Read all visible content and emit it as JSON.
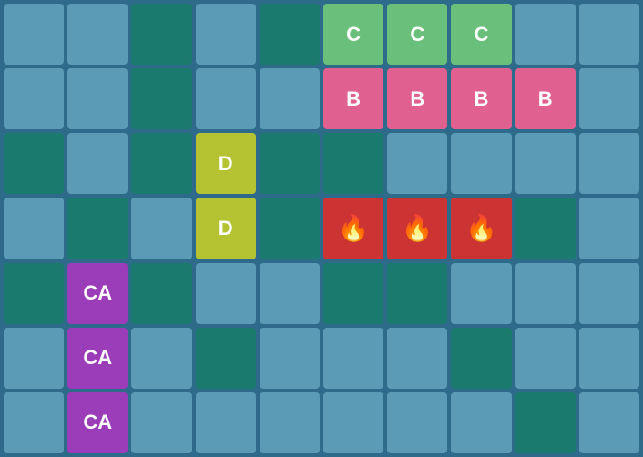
{
  "grid": {
    "cols": 10,
    "rows": 7,
    "cells": [
      {
        "id": "r0c0",
        "type": "light",
        "content": ""
      },
      {
        "id": "r0c1",
        "type": "light",
        "content": ""
      },
      {
        "id": "r0c2",
        "type": "teal",
        "content": "splash"
      },
      {
        "id": "r0c3",
        "type": "light",
        "content": ""
      },
      {
        "id": "r0c4",
        "type": "teal",
        "content": "splash"
      },
      {
        "id": "r0c5",
        "type": "green-label",
        "content": "C"
      },
      {
        "id": "r0c6",
        "type": "green-label",
        "content": "C"
      },
      {
        "id": "r0c7",
        "type": "green-label",
        "content": "C"
      },
      {
        "id": "r0c8",
        "type": "light",
        "content": ""
      },
      {
        "id": "r0c9",
        "type": "light",
        "content": ""
      },
      {
        "id": "r1c0",
        "type": "light",
        "content": ""
      },
      {
        "id": "r1c1",
        "type": "light",
        "content": ""
      },
      {
        "id": "r1c2",
        "type": "teal",
        "content": "splash"
      },
      {
        "id": "r1c3",
        "type": "light",
        "content": ""
      },
      {
        "id": "r1c4",
        "type": "light",
        "content": ""
      },
      {
        "id": "r1c5",
        "type": "pink-label",
        "content": "B"
      },
      {
        "id": "r1c6",
        "type": "pink-label",
        "content": "B"
      },
      {
        "id": "r1c7",
        "type": "pink-label",
        "content": "B"
      },
      {
        "id": "r1c8",
        "type": "pink-label",
        "content": "B"
      },
      {
        "id": "r1c9",
        "type": "light",
        "content": ""
      },
      {
        "id": "r2c0",
        "type": "teal",
        "content": "splash"
      },
      {
        "id": "r2c1",
        "type": "light",
        "content": ""
      },
      {
        "id": "r2c2",
        "type": "teal",
        "content": "splash"
      },
      {
        "id": "r2c3",
        "type": "yellow-green",
        "content": "D"
      },
      {
        "id": "r2c4",
        "type": "teal",
        "content": "splash"
      },
      {
        "id": "r2c5",
        "type": "teal",
        "content": "splash"
      },
      {
        "id": "r2c6",
        "type": "light",
        "content": ""
      },
      {
        "id": "r2c7",
        "type": "light",
        "content": ""
      },
      {
        "id": "r2c8",
        "type": "light",
        "content": ""
      },
      {
        "id": "r2c9",
        "type": "light",
        "content": ""
      },
      {
        "id": "r3c0",
        "type": "light",
        "content": ""
      },
      {
        "id": "r3c1",
        "type": "teal",
        "content": "splash"
      },
      {
        "id": "r3c2",
        "type": "light",
        "content": ""
      },
      {
        "id": "r3c3",
        "type": "yellow-green",
        "content": "D"
      },
      {
        "id": "r3c4",
        "type": "teal",
        "content": "splash"
      },
      {
        "id": "r3c5",
        "type": "red",
        "content": "fire"
      },
      {
        "id": "r3c6",
        "type": "red",
        "content": "fire"
      },
      {
        "id": "r3c7",
        "type": "red",
        "content": "fire"
      },
      {
        "id": "r3c8",
        "type": "teal",
        "content": "splash"
      },
      {
        "id": "r3c9",
        "type": "light",
        "content": ""
      },
      {
        "id": "r4c0",
        "type": "teal",
        "content": "splash"
      },
      {
        "id": "r4c1",
        "type": "purple",
        "content": "CA"
      },
      {
        "id": "r4c2",
        "type": "teal",
        "content": "splash"
      },
      {
        "id": "r4c3",
        "type": "light",
        "content": ""
      },
      {
        "id": "r4c4",
        "type": "light",
        "content": ""
      },
      {
        "id": "r4c5",
        "type": "teal",
        "content": "splash"
      },
      {
        "id": "r4c6",
        "type": "teal",
        "content": "splash"
      },
      {
        "id": "r4c7",
        "type": "light",
        "content": ""
      },
      {
        "id": "r4c8",
        "type": "light",
        "content": ""
      },
      {
        "id": "r4c9",
        "type": "light",
        "content": ""
      },
      {
        "id": "r5c0",
        "type": "light",
        "content": ""
      },
      {
        "id": "r5c1",
        "type": "purple",
        "content": "CA"
      },
      {
        "id": "r5c2",
        "type": "light",
        "content": ""
      },
      {
        "id": "r5c3",
        "type": "teal",
        "content": "splash"
      },
      {
        "id": "r5c4",
        "type": "light",
        "content": ""
      },
      {
        "id": "r5c5",
        "type": "light",
        "content": ""
      },
      {
        "id": "r5c6",
        "type": "light",
        "content": ""
      },
      {
        "id": "r5c7",
        "type": "teal",
        "content": "splash"
      },
      {
        "id": "r5c8",
        "type": "light",
        "content": ""
      },
      {
        "id": "r5c9",
        "type": "light",
        "content": ""
      },
      {
        "id": "r6c0",
        "type": "light",
        "content": ""
      },
      {
        "id": "r6c1",
        "type": "purple",
        "content": "CA"
      },
      {
        "id": "r6c2",
        "type": "light",
        "content": ""
      },
      {
        "id": "r6c3",
        "type": "light",
        "content": ""
      },
      {
        "id": "r6c4",
        "type": "light",
        "content": ""
      },
      {
        "id": "r6c5",
        "type": "light",
        "content": ""
      },
      {
        "id": "r6c6",
        "type": "light",
        "content": ""
      },
      {
        "id": "r6c7",
        "type": "light",
        "content": ""
      },
      {
        "id": "r6c8",
        "type": "teal",
        "content": "splash"
      },
      {
        "id": "r6c9",
        "type": "light",
        "content": ""
      }
    ]
  },
  "labels": {
    "C": "C",
    "B": "B",
    "D": "D",
    "CA": "CA",
    "fire": "🔥"
  }
}
